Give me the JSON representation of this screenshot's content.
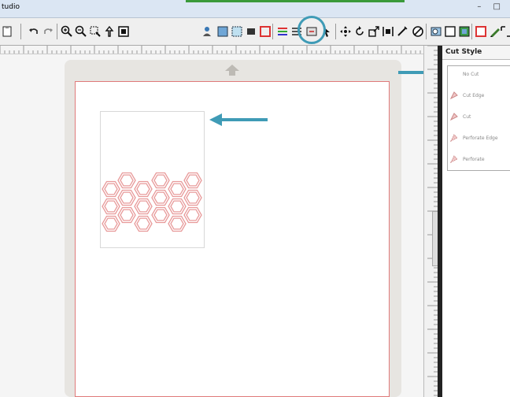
{
  "window": {
    "title": "tudio"
  },
  "panel": {
    "header": "Cut Style",
    "cut_styles": [
      "No Cut",
      "Cut Edge",
      "Cut",
      "Perforate Edge",
      "Perforate"
    ]
  },
  "colors": {
    "annotation": "#3f9bb6",
    "cut_line": "#e07a7a",
    "hex_stroke": "#e89a9a"
  },
  "toolbar_icons": [
    "paste-icon",
    "undo-icon",
    "redo-icon",
    "zoom-in-icon",
    "zoom-out-icon",
    "zoom-select-icon",
    "pan-icon",
    "fit-page-icon",
    "user-icon",
    "page-setup-icon",
    "registration-icon",
    "fill-icon",
    "line-style-icon",
    "grid-icon",
    "lines-icon",
    "cut-settings-icon",
    "pointer-icon",
    "move-icon",
    "rotate-icon",
    "scale-icon",
    "align-icon",
    "replicate-icon",
    "pen-icon",
    "trace-icon",
    "panel-a-icon",
    "panel-b-icon",
    "panel-c-icon",
    "pencil-icon",
    "expand-icon"
  ]
}
